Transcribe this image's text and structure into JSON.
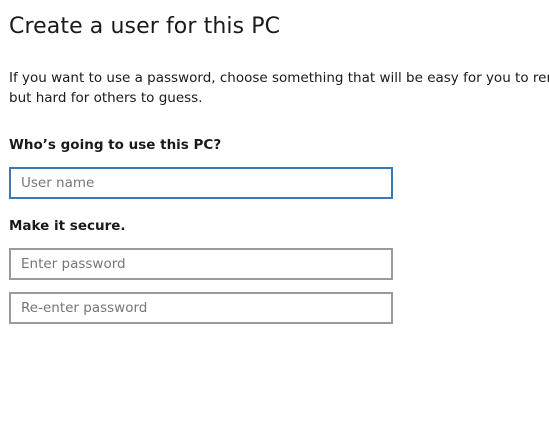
{
  "page": {
    "title": "Create a user for this PC",
    "description_line1": "If you want to use a password, choose something that will be easy for you to remember",
    "description_line2": "but hard for others to guess."
  },
  "user_section": {
    "label": "Who’s going to use this PC?",
    "username_placeholder": "User name",
    "username_value": ""
  },
  "security_section": {
    "label": "Make it secure.",
    "password_placeholder": "Enter password",
    "reenter_placeholder": "Re-enter password"
  },
  "colors": {
    "focus_border": "#3a78b8",
    "field_border": "#9a9a9a",
    "text": "#1a1a1a"
  }
}
